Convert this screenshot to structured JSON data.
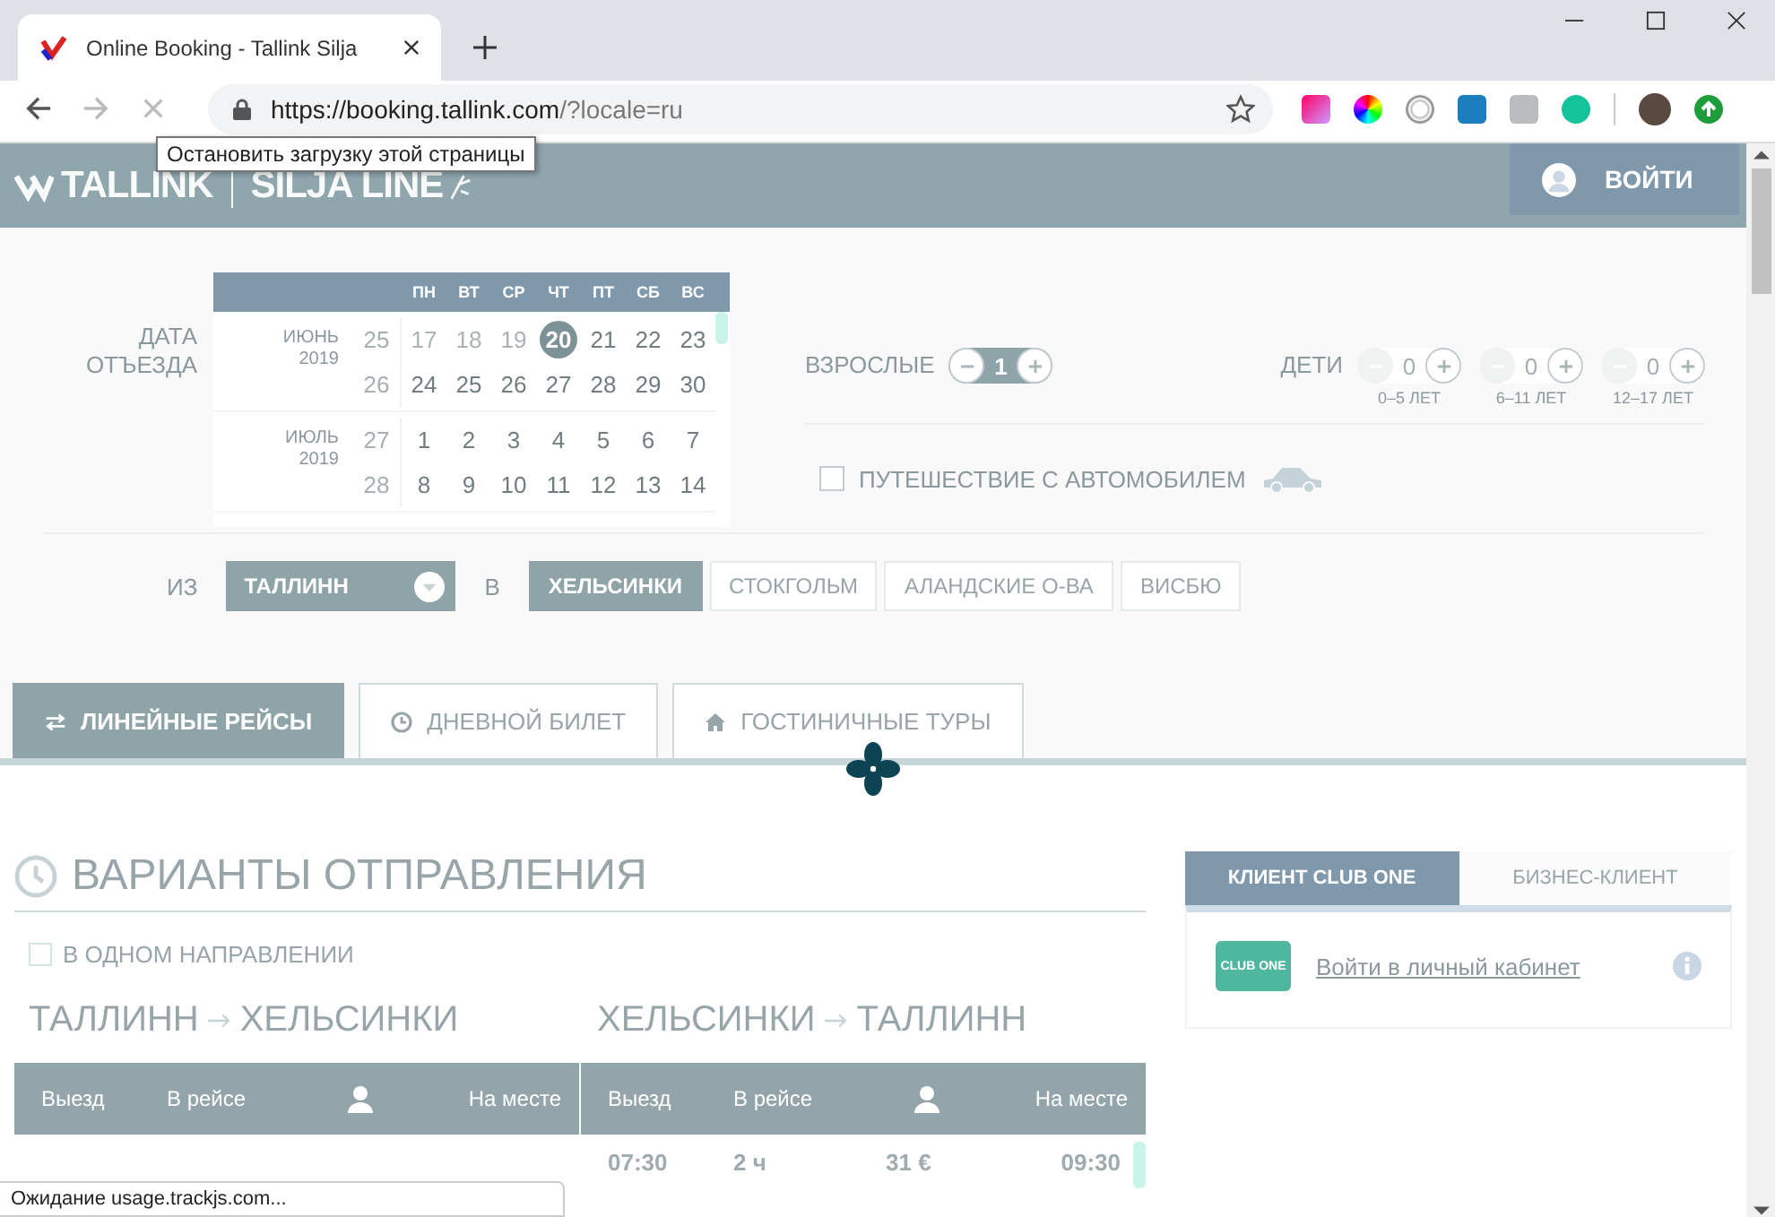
{
  "browser": {
    "tab_title": "Online Booking - Tallink Silja",
    "url_host": "https://booking.tallink.com",
    "url_path": "/?locale=ru",
    "tooltip": "Остановить загрузку этой страницы",
    "status": "Ожидание usage.trackjs.com..."
  },
  "header": {
    "logo_left": "TALLINK",
    "logo_right": "SILJA LINE",
    "login": "ВОЙТИ"
  },
  "date": {
    "label": "ДАТА ОТЪЕЗДА",
    "weekdays": [
      "ПН",
      "ВТ",
      "СР",
      "ЧТ",
      "ПТ",
      "СБ",
      "ВС"
    ],
    "months": [
      {
        "month": "ИЮНЬ",
        "year": "2019",
        "weeks": [
          {
            "week": "25",
            "days": [
              {
                "label": "17",
                "disabled": true,
                "selected": false
              },
              {
                "label": "18",
                "disabled": true,
                "selected": false
              },
              {
                "label": "19",
                "disabled": true,
                "selected": false
              },
              {
                "label": "20",
                "disabled": false,
                "selected": true
              },
              {
                "label": "21",
                "disabled": false,
                "selected": false
              },
              {
                "label": "22",
                "disabled": false,
                "selected": false
              },
              {
                "label": "23",
                "disabled": false,
                "selected": false
              }
            ]
          },
          {
            "week": "26",
            "days": [
              {
                "label": "24",
                "disabled": false,
                "selected": false
              },
              {
                "label": "25",
                "disabled": false,
                "selected": false
              },
              {
                "label": "26",
                "disabled": false,
                "selected": false
              },
              {
                "label": "27",
                "disabled": false,
                "selected": false
              },
              {
                "label": "28",
                "disabled": false,
                "selected": false
              },
              {
                "label": "29",
                "disabled": false,
                "selected": false
              },
              {
                "label": "30",
                "disabled": false,
                "selected": false
              }
            ]
          }
        ]
      },
      {
        "month": "ИЮЛЬ",
        "year": "2019",
        "weeks": [
          {
            "week": "27",
            "days": [
              {
                "label": "1",
                "disabled": false,
                "selected": false
              },
              {
                "label": "2",
                "disabled": false,
                "selected": false
              },
              {
                "label": "3",
                "disabled": false,
                "selected": false
              },
              {
                "label": "4",
                "disabled": false,
                "selected": false
              },
              {
                "label": "5",
                "disabled": false,
                "selected": false
              },
              {
                "label": "6",
                "disabled": false,
                "selected": false
              },
              {
                "label": "7",
                "disabled": false,
                "selected": false
              }
            ]
          },
          {
            "week": "28",
            "days": [
              {
                "label": "8",
                "disabled": false,
                "selected": false
              },
              {
                "label": "9",
                "disabled": false,
                "selected": false
              },
              {
                "label": "10",
                "disabled": false,
                "selected": false
              },
              {
                "label": "11",
                "disabled": false,
                "selected": false
              },
              {
                "label": "12",
                "disabled": false,
                "selected": false
              },
              {
                "label": "13",
                "disabled": false,
                "selected": false
              },
              {
                "label": "14",
                "disabled": false,
                "selected": false
              }
            ]
          }
        ]
      }
    ]
  },
  "passengers": {
    "adults": {
      "label": "ВЗРОСЛЫЕ",
      "value": "1",
      "minus_disabled": false
    },
    "children_label": "ДЕТИ",
    "children": [
      {
        "value": "0",
        "ages": "0–5 ЛЕТ",
        "minus_disabled": true
      },
      {
        "value": "0",
        "ages": "6–11 ЛЕТ",
        "minus_disabled": true
      },
      {
        "value": "0",
        "ages": "12–17 ЛЕТ",
        "minus_disabled": true
      }
    ]
  },
  "car": {
    "label": "ПУТЕШЕСТВИЕ С АВТОМОБИЛЕМ",
    "checked": false
  },
  "route": {
    "from_label": "ИЗ",
    "from": "ТАЛЛИНН",
    "to_label": "В",
    "destinations": [
      {
        "label": "ХЕЛЬСИНКИ",
        "selected": true
      },
      {
        "label": "СТОКГОЛЬМ",
        "selected": false
      },
      {
        "label": "АЛАНДСКИЕ О-ВА",
        "selected": false
      },
      {
        "label": "ВИСБЮ",
        "selected": false
      }
    ]
  },
  "tabs": [
    {
      "label": "ЛИНЕЙНЫЕ РЕЙСЫ",
      "kind": "arrows",
      "selected": true
    },
    {
      "label": "ДНЕВНОЙ БИЛЕТ",
      "kind": "clock",
      "selected": false
    },
    {
      "label": "ГОСТИНИЧНЫЕ ТУРЫ",
      "kind": "home",
      "selected": false
    }
  ],
  "departures": {
    "title": "ВАРИАНТЫ ОТПРАВЛЕНИЯ",
    "one_way": {
      "label": "В ОДНОМ НАПРАВЛЕНИИ",
      "checked": false
    },
    "legs": [
      {
        "from": "ТАЛЛИНН",
        "to": "ХЕЛЬСИНКИ",
        "columns": [
          "Выезд",
          "В рейсе",
          "На месте"
        ]
      },
      {
        "from": "ХЕЛЬСИНКИ",
        "to": "ТАЛЛИНН",
        "columns": [
          "Выезд",
          "В рейсе",
          "На месте"
        ],
        "rows": [
          {
            "depart": "07:30",
            "duration": "2 ч",
            "price": "31 €",
            "arrive": "09:30"
          }
        ]
      }
    ]
  },
  "client": {
    "tabs": [
      {
        "label": "КЛИЕНТ CLUB ONE",
        "selected": true
      },
      {
        "label": "БИЗНЕС-КЛИЕНТ",
        "selected": false
      }
    ],
    "badge": "CLUB ONE",
    "link": "Войти в личный кабинет"
  }
}
